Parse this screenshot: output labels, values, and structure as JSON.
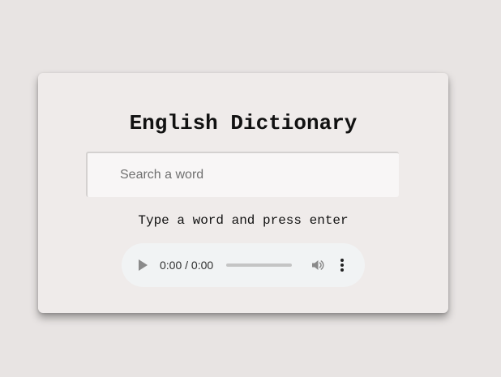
{
  "app": {
    "title": "English Dictionary"
  },
  "search": {
    "placeholder": "Search a word",
    "value": ""
  },
  "info": {
    "text": "Type a word and press enter"
  },
  "audio": {
    "time_display": "0:00 / 0:00",
    "progress": 0,
    "icons": [
      "play-icon",
      "volume-icon",
      "more-options-icon"
    ]
  },
  "colors": {
    "page_background": "#e8e4e3",
    "card_background": "#efebea",
    "audio_background": "#f1f3f4"
  }
}
